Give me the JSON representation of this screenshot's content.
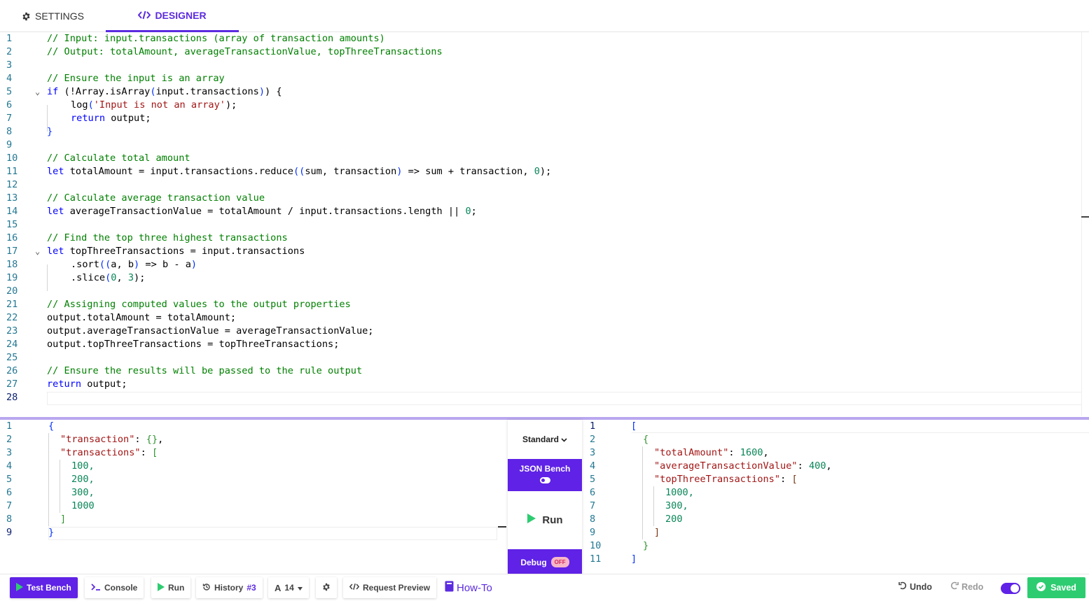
{
  "tabs": {
    "settings": "SETTINGS",
    "designer": "DESIGNER",
    "active": "designer"
  },
  "editor": {
    "line_numbers": [
      "1",
      "2",
      "3",
      "4",
      "5",
      "6",
      "7",
      "8",
      "9",
      "10",
      "11",
      "12",
      "13",
      "14",
      "15",
      "16",
      "17",
      "18",
      "19",
      "20",
      "21",
      "22",
      "23",
      "24",
      "25",
      "26",
      "27",
      "28"
    ],
    "lines": {
      "l1": "// Input: input.transactions (array of transaction amounts)",
      "l2": "// Output: totalAmount, averageTransactionValue, topThreeTransactions",
      "l4": "// Ensure the input is an array",
      "l5": {
        "a": "if",
        "b": " (",
        "c": "!Array.isArray",
        "d": "(",
        "e": "input.transactions",
        "f": ")",
        "g": ") {"
      },
      "l6": {
        "a": "log",
        "b": "(",
        "c": "'Input is not an array'",
        "d": ");"
      },
      "l7": {
        "a": "return",
        "b": " output;"
      },
      "l8": "}",
      "l10": "// Calculate total amount",
      "l11": {
        "a": "let",
        "b": " totalAmount = input.transactions.reduce",
        "c": "((",
        "d": "sum, transaction",
        "e": ")",
        "f": " => sum + transaction, ",
        "g": "0",
        "h": ");"
      },
      "l13": "// Calculate average transaction value",
      "l14": {
        "a": "let",
        "b": " averageTransactionValue = totalAmount / input.transactions.length || ",
        "c": "0",
        "d": ";"
      },
      "l16": "// Find the top three highest transactions",
      "l17": {
        "a": "let",
        "b": " topThreeTransactions = input.transactions"
      },
      "l18": {
        "a": ".sort",
        "b": "((",
        "c": "a, b",
        "d": ")",
        "e": " => b - a",
        "f": ")"
      },
      "l19": {
        "a": ".slice",
        "b": "(",
        "c": "0",
        "d": ", ",
        "e": "3",
        "f": ");"
      },
      "l21": "// Assigning computed values to the output properties",
      "l22": "output.totalAmount = totalAmount;",
      "l23": "output.averageTransactionValue = averageTransactionValue;",
      "l24": "output.topThreeTransactions = topThreeTransactions;",
      "l26": "// Ensure the results will be passed to the rule output",
      "l27": {
        "a": "return",
        "b": " output;"
      }
    }
  },
  "input_pane": {
    "line_numbers": [
      "1",
      "2",
      "3",
      "4",
      "5",
      "6",
      "7",
      "8",
      "9"
    ],
    "l1": "{",
    "l2": {
      "key": "\"transaction\"",
      "rest": ": ",
      "val": "{}",
      "end": ","
    },
    "l3": {
      "key": "\"transactions\"",
      "rest": ": ",
      "val": "["
    },
    "l4": "100,",
    "l5": "200,",
    "l6": "300,",
    "l7": "1000",
    "l8": "]",
    "l9": "}"
  },
  "output_pane": {
    "line_numbers": [
      "1",
      "2",
      "3",
      "4",
      "5",
      "6",
      "7",
      "8",
      "9",
      "10",
      "11"
    ],
    "l1": "[",
    "l2": "{",
    "l3": {
      "key": "\"totalAmount\"",
      "rest": ": ",
      "val": "1600",
      "end": ","
    },
    "l4": {
      "key": "\"averageTransactionValue\"",
      "rest": ": ",
      "val": "400",
      "end": ","
    },
    "l5": {
      "key": "\"topThreeTransactions\"",
      "rest": ": ",
      "val": "["
    },
    "l6": "1000,",
    "l7": "300,",
    "l8": "200",
    "l9": "]",
    "l10": "}",
    "l11": "]"
  },
  "controls": {
    "mode": "Standard",
    "json_bench": "JSON Bench",
    "run": "Run",
    "debug": "Debug",
    "debug_state": "OFF"
  },
  "toolbar": {
    "test_bench": "Test Bench",
    "console": "Console",
    "run": "Run",
    "history": "History",
    "history_num": "#3",
    "font_size": "14",
    "request_preview": "Request Preview",
    "how_to": "How-To",
    "undo": "Undo",
    "redo": "Redo",
    "saved": "Saved"
  },
  "colors": {
    "accent": "#5f22e6",
    "saved": "#2ecc71",
    "comment": "#008000",
    "keyword": "#0000ff",
    "string": "#a31515",
    "number": "#098658"
  },
  "icons": {
    "settings_tab": "gear-icon",
    "designer_tab": "code-icon",
    "test_bench": "play-icon",
    "console": "terminal-icon",
    "run": "play-icon",
    "history": "history-icon",
    "font": "font-size-icon",
    "settings": "gear-icon",
    "request_preview": "code-icon",
    "how_to": "book-icon",
    "undo": "undo-icon",
    "redo": "redo-icon",
    "saved": "check-circle-icon"
  }
}
